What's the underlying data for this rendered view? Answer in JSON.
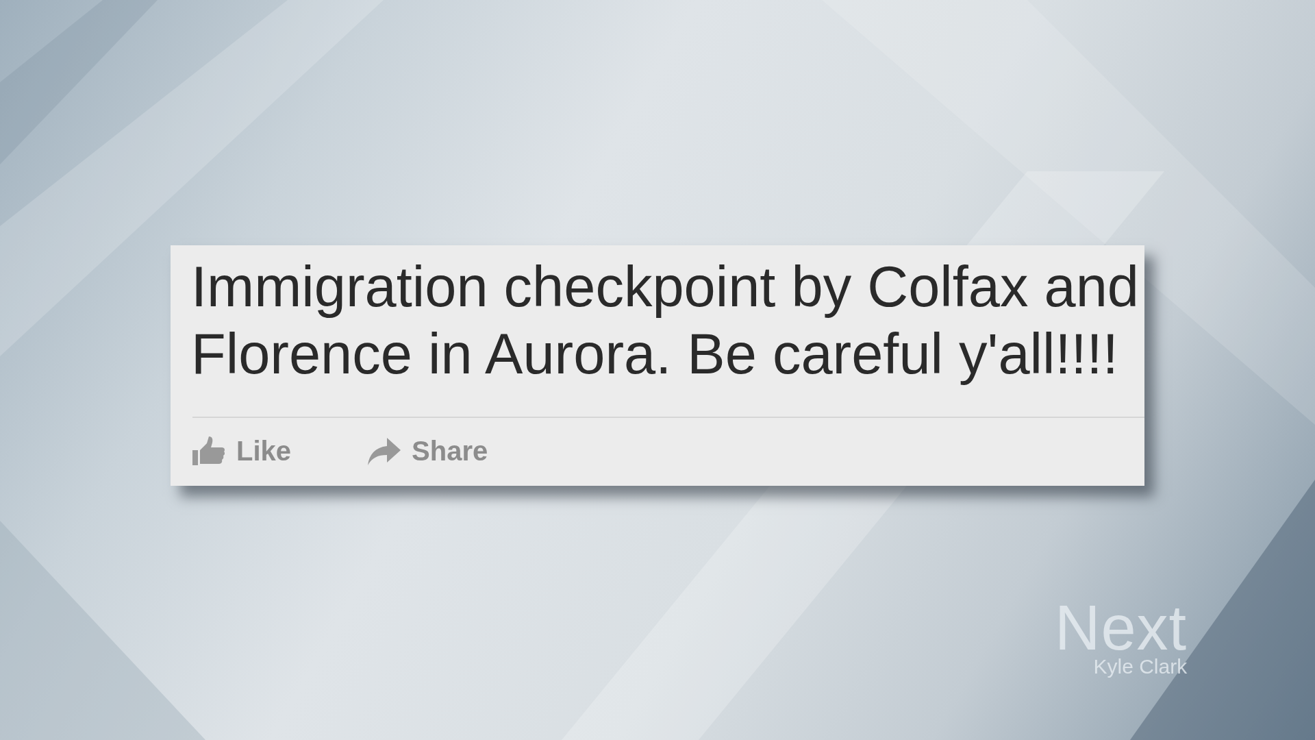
{
  "post": {
    "text": "Immigration checkpoint by Colfax and Florence in Aurora. Be careful y'all!!!!",
    "actions": [
      {
        "kind": "like",
        "label": "Like"
      },
      {
        "kind": "share",
        "label": "Share"
      }
    ]
  },
  "show_logo": {
    "title": "Next",
    "byline": "Kyle Clark"
  }
}
